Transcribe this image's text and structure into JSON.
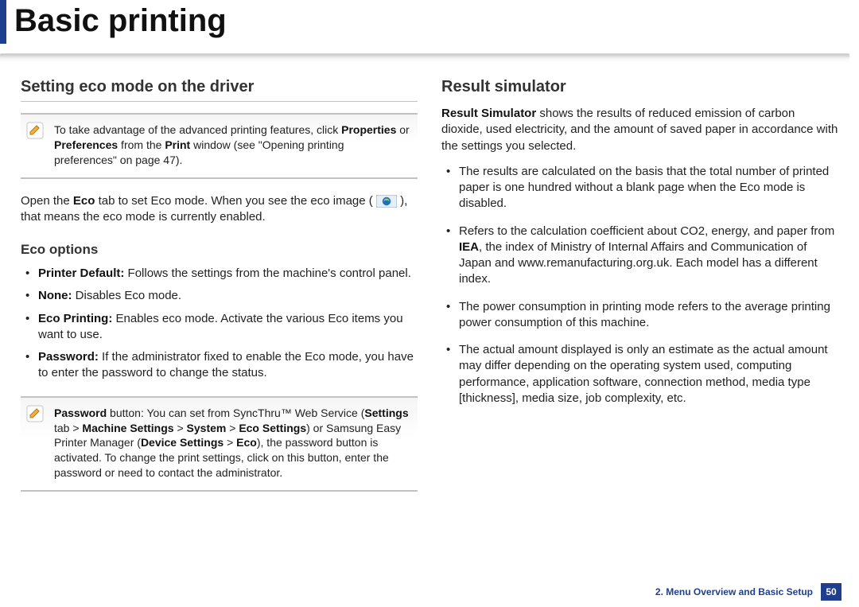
{
  "page_title": "Basic printing",
  "left": {
    "section_heading": "Setting eco mode on the driver",
    "note1_pre": "To take advantage of the advanced printing features, click ",
    "note1_b1": "Properties",
    "note1_mid1": " or ",
    "note1_b2": "Preferences",
    "note1_mid2": " from the ",
    "note1_b3": "Print",
    "note1_tail": " window (see \"Opening printing preferences\" on page 47).",
    "open_eco_pre": "Open the ",
    "open_eco_b": "Eco",
    "open_eco_mid": " tab to set Eco mode. When you see the eco image ( ",
    "open_eco_post": " ), that means the eco mode is currently enabled.",
    "eco_options_heading": "Eco options",
    "opts": [
      {
        "bold": "Printer Default:",
        "rest": " Follows the settings from the machine's control panel."
      },
      {
        "bold": "None:",
        "rest": " Disables Eco mode."
      },
      {
        "bold": "Eco Printing:",
        "rest": " Enables eco mode. Activate the various Eco items you want to use."
      },
      {
        "bold": "Password:",
        "rest": " If the administrator fixed to enable the Eco mode, you have to enter the password to change the status."
      }
    ],
    "note2_pre": "",
    "note2_b1": "Password",
    "note2_t1": " button: You can set from SyncThru™ Web Service (",
    "note2_b2": "Settings",
    "note2_t2": " tab > ",
    "note2_b3": "Machine Settings",
    "note2_t3": " > ",
    "note2_b4": "System",
    "note2_t4": " > ",
    "note2_b5": "Eco Settings",
    "note2_t5": ") or Samsung Easy Printer Manager (",
    "note2_b6": "Device Settings",
    "note2_t6": " > ",
    "note2_b7": "Eco",
    "note2_t7": "), the password button is activated. To change the print settings, click on this button, enter the password or need to contact the administrator."
  },
  "right": {
    "section_heading": "Result simulator",
    "intro_b": "Result Simulator",
    "intro_rest": " shows the results of reduced emission of carbon dioxide, used electricity, and the amount of saved paper in accordance with the settings you selected.",
    "items": [
      {
        "pre": "The results are calculated on the basis that the total number of printed paper is one hundred without a blank page when the Eco mode is disabled.",
        "bold": "",
        "post": ""
      },
      {
        "pre": "Refers to the calculation coefficient about CO2, energy, and paper from ",
        "bold": "IEA",
        "post": ", the index of Ministry of Internal Affairs and Communication of Japan and www.remanufacturing.org.uk. Each model has a different index."
      },
      {
        "pre": "The power consumption in printing mode refers to the average printing power consumption of this machine.",
        "bold": "",
        "post": ""
      },
      {
        "pre": "The actual amount displayed is only an estimate as the actual amount may differ depending on the operating system used, computing performance, application software, connection method, media type [thickness], media size, job complexity, etc.",
        "bold": "",
        "post": ""
      }
    ]
  },
  "footer": {
    "chapter": "2. Menu Overview and Basic Setup",
    "page": "50"
  }
}
